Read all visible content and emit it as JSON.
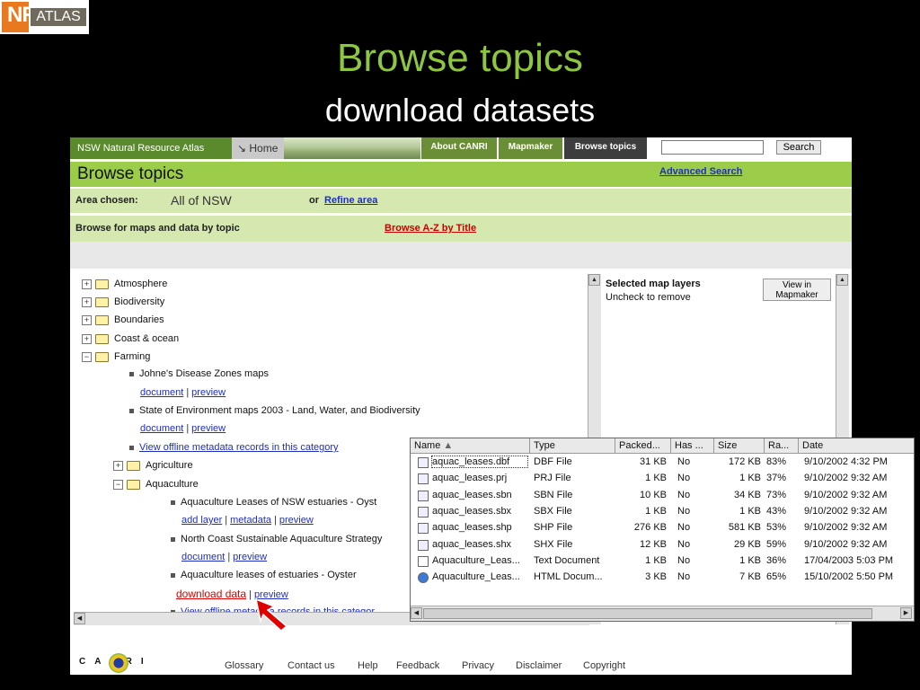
{
  "logo": {
    "nsw": "NSW",
    "nr": "NR",
    "atlas": "ATLAS"
  },
  "slide": {
    "title": "Browse topics",
    "subtitle": "download datasets"
  },
  "topbar": {
    "brand": "NSW Natural Resource Atlas",
    "home": "Home",
    "about": "About CANRI",
    "mapmaker": "Mapmaker",
    "browse": "Browse topics",
    "search_button": "Search"
  },
  "header": {
    "title": "Browse topics",
    "advanced_search": "Advanced Search",
    "area_label": "Area chosen:",
    "area_value": "All of NSW",
    "or": "or",
    "refine": "Refine area",
    "browse_label": "Browse for maps and data by topic",
    "browse_az": "Browse A-Z by Title"
  },
  "tree": {
    "atmosphere": "Atmosphere",
    "biodiversity": "Biodiversity",
    "boundaries": "Boundaries",
    "coast": "Coast & ocean",
    "farming": "Farming",
    "johnes": "Johne's Disease Zones maps",
    "document": "document",
    "preview": "preview",
    "soe": "State of Environment maps 2003 - Land, Water, and Biodiversity",
    "offline": "View offline metadata records in this category",
    "agriculture": "Agriculture",
    "aquaculture": "Aquaculture",
    "aq_leases": "Aquaculture Leases of NSW estuaries - Oyst",
    "add_layer": "add layer",
    "metadata": "metadata",
    "north_coast": "North Coast Sustainable Aquaculture Strategy",
    "aq_leases_oyster": "Aquaculture leases of estuaries - Oyster",
    "download_data": "download data",
    "offline_cut": "View offline metadata records in this categor"
  },
  "selected": {
    "title": "Selected map layers",
    "subtitle": "Uncheck to remove",
    "view_button_line1": "View in",
    "view_button_line2": "Mapmaker"
  },
  "footer": {
    "canri": "CANRI",
    "links": [
      "Glossary",
      "Contact us",
      "Help",
      "Feedback",
      "Privacy",
      "Disclaimer",
      "Copyright"
    ]
  },
  "files": {
    "columns": [
      "Name",
      "Type",
      "Packed...",
      "Has ...",
      "Size",
      "Ra...",
      "Date"
    ],
    "rows": [
      {
        "icon": "dbf-file-icon",
        "name": "aquac_leases.dbf",
        "type": "DBF File",
        "packed": "31 KB",
        "has": "No",
        "size": "172 KB",
        "ratio": "83%",
        "date": "9/10/2002 4:32 PM"
      },
      {
        "icon": "prj-file-icon",
        "name": "aquac_leases.prj",
        "type": "PRJ File",
        "packed": "1 KB",
        "has": "No",
        "size": "1 KB",
        "ratio": "37%",
        "date": "9/10/2002 9:32 AM"
      },
      {
        "icon": "sbn-file-icon",
        "name": "aquac_leases.sbn",
        "type": "SBN File",
        "packed": "10 KB",
        "has": "No",
        "size": "34 KB",
        "ratio": "73%",
        "date": "9/10/2002 9:32 AM"
      },
      {
        "icon": "sbx-file-icon",
        "name": "aquac_leases.sbx",
        "type": "SBX File",
        "packed": "1 KB",
        "has": "No",
        "size": "1 KB",
        "ratio": "43%",
        "date": "9/10/2002 9:32 AM"
      },
      {
        "icon": "shp-file-icon",
        "name": "aquac_leases.shp",
        "type": "SHP File",
        "packed": "276 KB",
        "has": "No",
        "size": "581 KB",
        "ratio": "53%",
        "date": "9/10/2002 9:32 AM"
      },
      {
        "icon": "shx-file-icon",
        "name": "aquac_leases.shx",
        "type": "SHX File",
        "packed": "12 KB",
        "has": "No",
        "size": "29 KB",
        "ratio": "59%",
        "date": "9/10/2002 9:32 AM"
      },
      {
        "icon": "text-document-icon",
        "name": "Aquaculture_Leas...",
        "type": "Text Document",
        "packed": "1 KB",
        "has": "No",
        "size": "1 KB",
        "ratio": "36%",
        "date": "17/04/2003 5:03 PM"
      },
      {
        "icon": "html-document-icon",
        "name": "Aquaculture_Leas...",
        "type": "HTML Docum...",
        "packed": "3 KB",
        "has": "No",
        "size": "7 KB",
        "ratio": "65%",
        "date": "15/10/2002 5:50 PM"
      }
    ]
  },
  "colors": {
    "title_green": "#8dc63f",
    "header_green": "#9ccd4a",
    "light_green": "#d5e8b0",
    "link_blue": "#1f2fbf",
    "arrow_red": "#e00000"
  }
}
